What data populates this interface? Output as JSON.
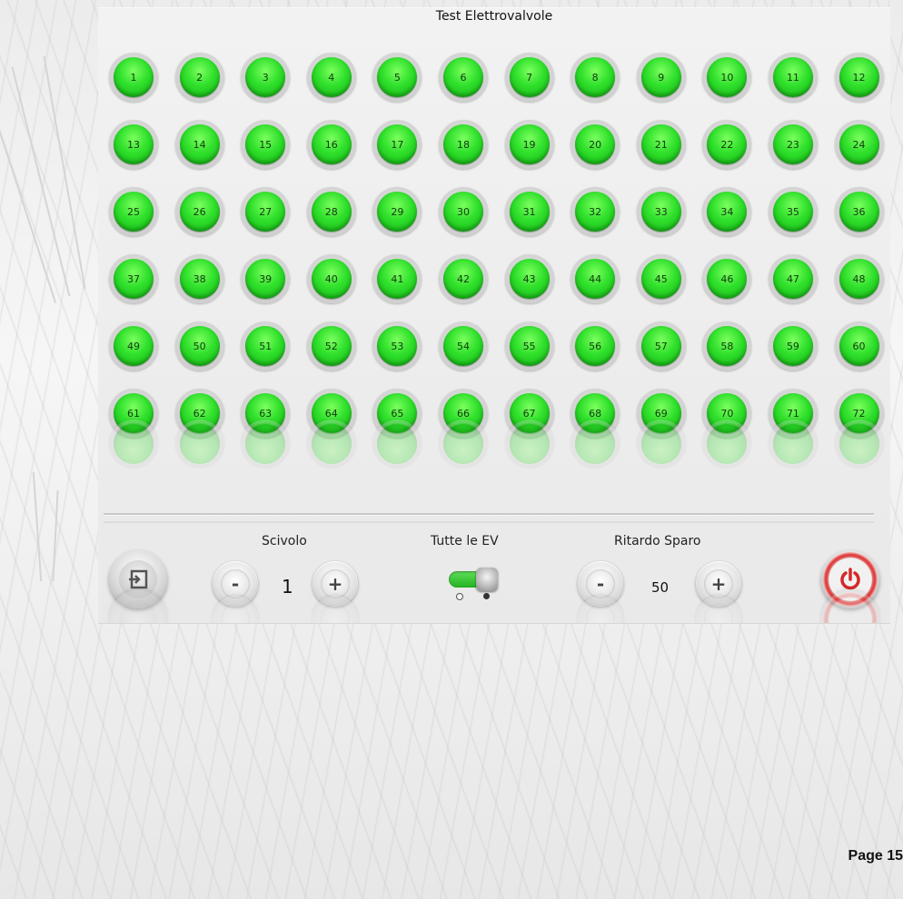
{
  "title": "Test Elettrovalvole",
  "valves": [
    "1",
    "2",
    "3",
    "4",
    "5",
    "6",
    "7",
    "8",
    "9",
    "10",
    "11",
    "12",
    "13",
    "14",
    "15",
    "16",
    "17",
    "18",
    "19",
    "20",
    "21",
    "22",
    "23",
    "24",
    "25",
    "26",
    "27",
    "28",
    "29",
    "30",
    "31",
    "32",
    "33",
    "34",
    "35",
    "36",
    "37",
    "38",
    "39",
    "40",
    "41",
    "42",
    "43",
    "44",
    "45",
    "46",
    "47",
    "48",
    "49",
    "50",
    "51",
    "52",
    "53",
    "54",
    "55",
    "56",
    "57",
    "58",
    "59",
    "60",
    "61",
    "62",
    "63",
    "64",
    "65",
    "66",
    "67",
    "68",
    "69",
    "70",
    "71",
    "72"
  ],
  "valve_color": "#2fe02b",
  "controls": {
    "exit_icon": "exit-icon",
    "scivolo": {
      "label": "Scivolo",
      "value": "1",
      "minus": "-",
      "plus": "+"
    },
    "all_ev": {
      "label": "Tutte le EV",
      "state": "on"
    },
    "ritardo": {
      "label": "Ritardo Sparo",
      "value": "50",
      "minus": "-",
      "plus": "+"
    },
    "power_icon": "power-icon",
    "power_color": "#d62828"
  },
  "page_label": "Page 15"
}
